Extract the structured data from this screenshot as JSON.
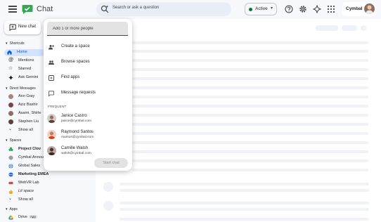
{
  "header": {
    "app_title": "Chat",
    "menu_icon": "hamburger-menu-icon",
    "search": {
      "placeholder": "Search or ask a question",
      "icon": "sparkle-search-icon"
    },
    "status": {
      "label": "Active",
      "dot_color": "#146c2e"
    },
    "icons": [
      "help-icon",
      "settings-icon",
      "gemini-icon",
      "apps-grid-icon"
    ],
    "account": {
      "org": "Cymbal"
    }
  },
  "sidebar": {
    "new_chat_label": "New chat",
    "shortcuts": {
      "heading": "Shortcuts",
      "items": [
        {
          "label": "Home",
          "icon": "home-icon",
          "active": true
        },
        {
          "label": "Mentions",
          "icon": "at-icon"
        },
        {
          "label": "Starred",
          "icon": "star-icon"
        },
        {
          "label": "Ask Gemini",
          "icon": "gemini-icon"
        }
      ]
    },
    "direct_messages": {
      "heading": "Direct Messages",
      "items": [
        {
          "label": "Ann Gray"
        },
        {
          "label": "Aziz Bashir"
        },
        {
          "label": "Asami, Shirle"
        },
        {
          "label": "Stephen Liu"
        },
        {
          "label": "Show all"
        }
      ]
    },
    "spaces": {
      "heading": "Spaces",
      "items": [
        {
          "label": "Project Clov"
        },
        {
          "label": "Cymbal Annou"
        },
        {
          "label": "Global Sales"
        },
        {
          "label": "Marketing EMEA"
        },
        {
          "label": "WebVR Lab"
        },
        {
          "label": "Lit space"
        },
        {
          "label": "Show all"
        }
      ]
    },
    "apps": {
      "heading": "Apps",
      "items": [
        {
          "label": "Drive",
          "badge": "App"
        }
      ]
    }
  },
  "popup": {
    "input_placeholder": "Add 1 or more people",
    "menu": [
      {
        "label": "Create a space",
        "icon": "add-people-icon"
      },
      {
        "label": "Browse spaces",
        "icon": "browse-spaces-icon"
      },
      {
        "label": "Find apps",
        "icon": "apps-icon"
      },
      {
        "label": "Message requests",
        "icon": "chat-request-icon"
      }
    ],
    "frequent_heading": "FREQUENT",
    "contacts": [
      {
        "name": "Janice Castro",
        "email": "janice@cymbal.com"
      },
      {
        "name": "Raymond Santos",
        "email": "rsantos@cymbal.com"
      },
      {
        "name": "Camille Walsh",
        "email": "walsh@cymbal.com"
      }
    ],
    "start_chat_label": "Start chat"
  }
}
